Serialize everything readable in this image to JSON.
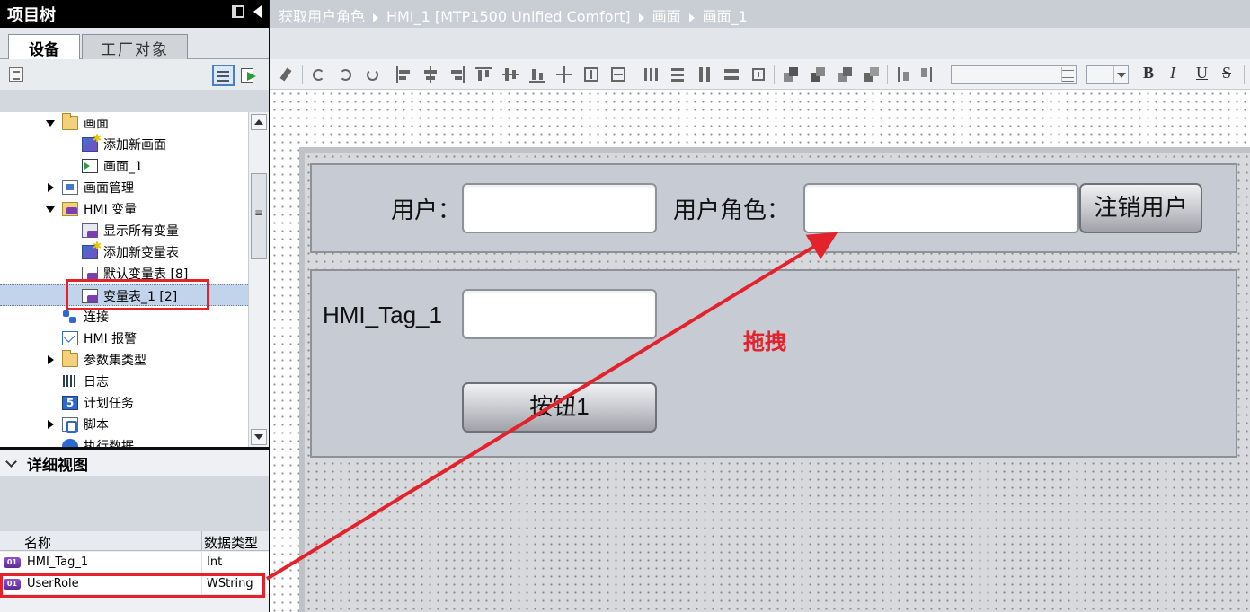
{
  "project_tree": {
    "title": "项目树",
    "tabs": [
      {
        "label": "设备"
      },
      {
        "label": "工厂对象"
      }
    ],
    "items": [
      {
        "label": "画面",
        "icon": "folder-icon"
      },
      {
        "label": "添加新画面",
        "icon": "add-screen-icon"
      },
      {
        "label": "画面_1",
        "icon": "screen-icon"
      },
      {
        "label": "画面管理",
        "icon": "screen-management-icon"
      },
      {
        "label": "HMI 变量",
        "icon": "hmi-tags-folder-icon"
      },
      {
        "label": "显示所有变量",
        "icon": "show-all-tags-icon"
      },
      {
        "label": "添加新变量表",
        "icon": "add-tag-table-icon"
      },
      {
        "label": "默认变量表 [8]",
        "icon": "tag-table-icon"
      },
      {
        "label": "变量表_1 [2]",
        "icon": "tag-table-icon"
      },
      {
        "label": "连接",
        "icon": "connections-icon"
      },
      {
        "label": "HMI 报警",
        "icon": "alarm-icon"
      },
      {
        "label": "参数集类型",
        "icon": "folder-icon"
      },
      {
        "label": "日志",
        "icon": "logs-icon"
      },
      {
        "label": "计划任务",
        "icon": "scheduled-tasks-icon"
      },
      {
        "label": "脚本",
        "icon": "scripts-icon"
      },
      {
        "label": "执行数据",
        "icon": "runtime-data-icon"
      }
    ]
  },
  "details_view": {
    "title": "详细视图",
    "columns": [
      "名称",
      "数据类型"
    ],
    "rows": [
      {
        "name": "HMI_Tag_1",
        "type": "Int"
      },
      {
        "name": "UserRole",
        "type": "WString"
      }
    ]
  },
  "editor": {
    "breadcrumb": [
      "获取用户角色",
      "HMI_1 [MTP1500 Unified Comfort]",
      "画面",
      "画面_1"
    ],
    "format_buttons": [
      "B",
      "I",
      "U",
      "S"
    ],
    "screen": {
      "user_label": "用户：",
      "user_role_label": "用户角色：",
      "logout_button": "注销用户",
      "tag_label": "HMI_Tag_1",
      "button1": "按钮1"
    }
  },
  "annotation": {
    "drag_text": "拖拽",
    "color": "#e3222b"
  },
  "colors": {
    "header_bg": "#000000",
    "breadcrumb_bg": "#c9ced5",
    "selection": "#c2d4ec",
    "screen_panel": "#c7cbd3"
  }
}
